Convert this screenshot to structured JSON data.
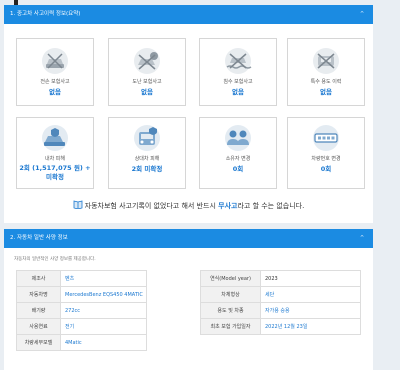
{
  "section1": {
    "title": "1. 중고차 사고이력 정보(요약)",
    "cards": [
      {
        "icon": "car-crash-icon",
        "label": "전손 보험사고",
        "value": "없음"
      },
      {
        "icon": "stolen-car-icon",
        "label": "도난 보험사고",
        "value": "없음"
      },
      {
        "icon": "flood-car-icon",
        "label": "침수 보험사고",
        "value": "없음"
      },
      {
        "icon": "special-use-car-icon",
        "label": "특수 용도 이력",
        "value": "없음"
      },
      {
        "icon": "own-car-damage-icon",
        "label": "내차 피해",
        "value": "2회 (1,517,075 원) +",
        "value2": "미확정"
      },
      {
        "icon": "other-car-damage-icon",
        "label": "상대차 피해",
        "value": "2회 미확정"
      },
      {
        "icon": "owner-change-icon",
        "label": "소유자 변경",
        "value": "0회"
      },
      {
        "icon": "plate-change-icon",
        "label": "차량번호 변경",
        "value": "0회"
      }
    ],
    "notice_pre": "자동차보험 사고기록이 없었다고 해서 반드시 ",
    "notice_bold": "무사고",
    "notice_post": "라고 할 수는 없습니다."
  },
  "section2": {
    "title": "2. 자동차 일반 사양 정보",
    "note": "자동차의 일반적인 사양 정보를 제공합니다.",
    "left": [
      {
        "key": "제조사",
        "value": "벤츠"
      },
      {
        "key": "자동차명",
        "value": "MercedesBenz EQS450 4MATIC"
      },
      {
        "key": "배기량",
        "value": "272cc"
      },
      {
        "key": "사용연료",
        "value": "전기"
      },
      {
        "key": "차량세부모델",
        "value": "4Matic"
      }
    ],
    "right": [
      {
        "key": "연식(Model year)",
        "value": "2023"
      },
      {
        "key": "차체형상",
        "value": "세단"
      },
      {
        "key": "용도 및 차종",
        "value": "자가용  승용"
      },
      {
        "key": "최초 보험 가입일자",
        "value": "2022년 12월 23일"
      }
    ]
  },
  "colors": {
    "header_blue": "#1b8be2",
    "value_blue": "#1b78d0"
  }
}
